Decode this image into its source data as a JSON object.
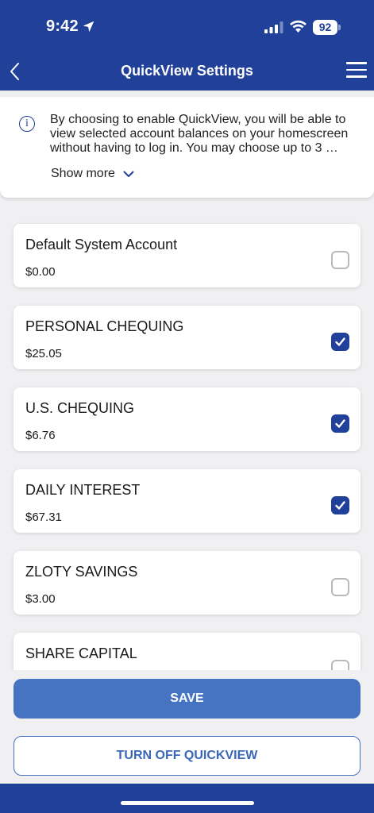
{
  "status_bar": {
    "time": "9:42",
    "battery": "92"
  },
  "header": {
    "title": "QuickView Settings"
  },
  "info": {
    "text": "By choosing to enable QuickView, you will be able to view selected account balances on your homescreen without having to log in. You may choose up to 3 …",
    "show_more": "Show more"
  },
  "accounts": [
    {
      "name": "Default System Account",
      "balance": "$0.00",
      "checked": false
    },
    {
      "name": "PERSONAL CHEQUING",
      "balance": "$25.05",
      "checked": true
    },
    {
      "name": "U.S. CHEQUING",
      "balance": "$6.76",
      "checked": true
    },
    {
      "name": "DAILY INTEREST",
      "balance": "$67.31",
      "checked": true
    },
    {
      "name": "ZLOTY SAVINGS",
      "balance": "$3.00",
      "checked": false
    },
    {
      "name": "SHARE CAPITAL",
      "balance": "",
      "checked": false
    }
  ],
  "buttons": {
    "save": "SAVE",
    "turn_off": "TURN OFF QUICKVIEW"
  },
  "colors": {
    "brand": "#21409a",
    "primary_button": "#4674c2"
  }
}
